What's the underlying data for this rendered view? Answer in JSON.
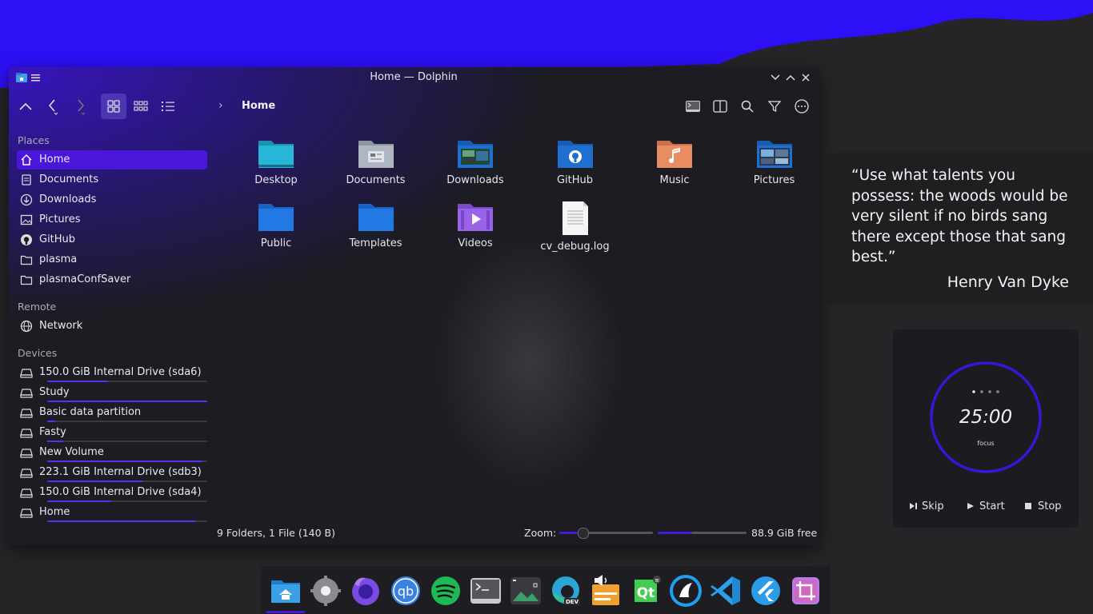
{
  "window": {
    "title": "Home — Dolphin",
    "breadcrumb": "Home"
  },
  "sidebar": {
    "places_title": "Places",
    "places": [
      {
        "label": "Home",
        "icon": "home-icon",
        "selected": true
      },
      {
        "label": "Documents",
        "icon": "documents-icon"
      },
      {
        "label": "Downloads",
        "icon": "download-icon"
      },
      {
        "label": "Pictures",
        "icon": "pictures-icon"
      },
      {
        "label": "GitHub",
        "icon": "github-icon"
      },
      {
        "label": "plasma",
        "icon": "folder-icon"
      },
      {
        "label": "plasmaConfSaver",
        "icon": "folder-icon"
      }
    ],
    "remote_title": "Remote",
    "remote": [
      {
        "label": "Network",
        "icon": "network-icon"
      }
    ],
    "devices_title": "Devices",
    "devices": [
      {
        "label": "150.0 GiB Internal Drive (sda6)",
        "usage": 0.38
      },
      {
        "label": "Study",
        "usage": 1.0
      },
      {
        "label": "Basic data partition",
        "usage": 0.05
      },
      {
        "label": "Fasty",
        "usage": 0.1
      },
      {
        "label": "New Volume",
        "usage": 0.97
      },
      {
        "label": "223.1 GiB Internal Drive (sdb3)",
        "usage": 0.6
      },
      {
        "label": "150.0 GiB Internal Drive (sda4)",
        "usage": 0.4
      },
      {
        "label": "Home",
        "usage": 0.93
      }
    ]
  },
  "files": [
    {
      "name": "Desktop",
      "kind": "desktop-folder-icon"
    },
    {
      "name": "Documents",
      "kind": "documents-folder-icon"
    },
    {
      "name": "Downloads",
      "kind": "downloads-folder-icon"
    },
    {
      "name": "GitHub",
      "kind": "github-folder-icon"
    },
    {
      "name": "Music",
      "kind": "music-folder-icon"
    },
    {
      "name": "Pictures",
      "kind": "pictures-folder-icon"
    },
    {
      "name": "Public",
      "kind": "folder-icon"
    },
    {
      "name": "Templates",
      "kind": "folder-icon"
    },
    {
      "name": "Videos",
      "kind": "videos-folder-icon"
    },
    {
      "name": "cv_debug.log",
      "kind": "text-file-icon"
    }
  ],
  "status": {
    "summary": "9 Folders, 1 File (140 B)",
    "zoom_label": "Zoom:",
    "zoom_level": 0.25,
    "free_label": "88.9 GiB free",
    "disk_usage": 0.39
  },
  "quote": {
    "text": "“Use what talents you possess: the woods would be very silent if no birds sang there except those that sang best.”",
    "author": "Henry Van Dyke"
  },
  "timer": {
    "time": "25:00",
    "mode": "focus",
    "skip": "Skip",
    "start": "Start",
    "stop": "Stop"
  },
  "dock": [
    {
      "name": "dolphin-icon",
      "active": true
    },
    {
      "name": "settings-icon"
    },
    {
      "name": "firefox-icon"
    },
    {
      "name": "qbittorrent-icon"
    },
    {
      "name": "spotify-icon"
    },
    {
      "name": "terminal-icon"
    },
    {
      "name": "screenshot-icon"
    },
    {
      "name": "edge-dev-icon"
    },
    {
      "name": "audio-icon"
    },
    {
      "name": "qt-icon"
    },
    {
      "name": "kde-connect-icon"
    },
    {
      "name": "vscode-icon"
    },
    {
      "name": "flutter-icon"
    },
    {
      "name": "crop-icon"
    }
  ],
  "colors": {
    "accent": "#4a17d8",
    "wallpaper_top": "#2e10ff",
    "window_bg": "#1c1c22"
  }
}
